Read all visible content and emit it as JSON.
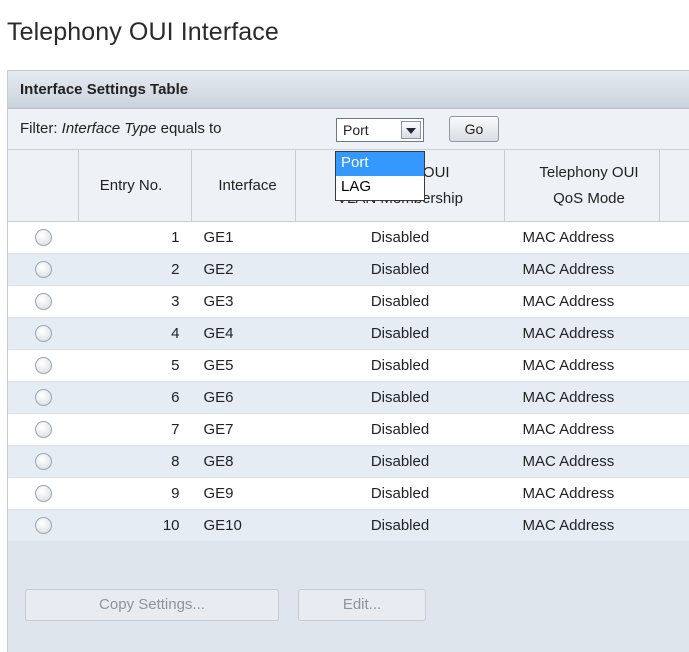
{
  "page": {
    "title": "Telephony OUI Interface"
  },
  "panel": {
    "title": "Interface Settings Table",
    "filter": {
      "label_prefix": "Filter:",
      "label_italic": "Interface Type",
      "label_suffix": "equals to",
      "selected": "Port",
      "options": [
        "Port",
        "LAG"
      ],
      "go_label": "Go"
    },
    "columns": [
      "",
      "Entry No.",
      "Interface",
      "Telephony OUI VLAN Membership",
      "Telephony OUI QoS Mode"
    ],
    "column_header_lines": {
      "vlan": [
        "Telephony OUI",
        "VLAN Membership"
      ],
      "qos": [
        "Telephony OUI",
        "QoS Mode"
      ]
    },
    "rows": [
      {
        "entry": "1",
        "interface": "GE1",
        "vlan": "Disabled",
        "qos": "MAC Address"
      },
      {
        "entry": "2",
        "interface": "GE2",
        "vlan": "Disabled",
        "qos": "MAC Address"
      },
      {
        "entry": "3",
        "interface": "GE3",
        "vlan": "Disabled",
        "qos": "MAC Address"
      },
      {
        "entry": "4",
        "interface": "GE4",
        "vlan": "Disabled",
        "qos": "MAC Address"
      },
      {
        "entry": "5",
        "interface": "GE5",
        "vlan": "Disabled",
        "qos": "MAC Address"
      },
      {
        "entry": "6",
        "interface": "GE6",
        "vlan": "Disabled",
        "qos": "MAC Address"
      },
      {
        "entry": "7",
        "interface": "GE7",
        "vlan": "Disabled",
        "qos": "MAC Address"
      },
      {
        "entry": "8",
        "interface": "GE8",
        "vlan": "Disabled",
        "qos": "MAC Address"
      },
      {
        "entry": "9",
        "interface": "GE9",
        "vlan": "Disabled",
        "qos": "MAC Address"
      },
      {
        "entry": "10",
        "interface": "GE10",
        "vlan": "Disabled",
        "qos": "MAC Address"
      }
    ],
    "buttons": {
      "copy_settings": "Copy Settings...",
      "edit": "Edit..."
    }
  },
  "colors": {
    "header_bg": "#dfe5ec",
    "row_alt": "#e5ecf3",
    "dropdown_highlight": "#3399ff"
  }
}
